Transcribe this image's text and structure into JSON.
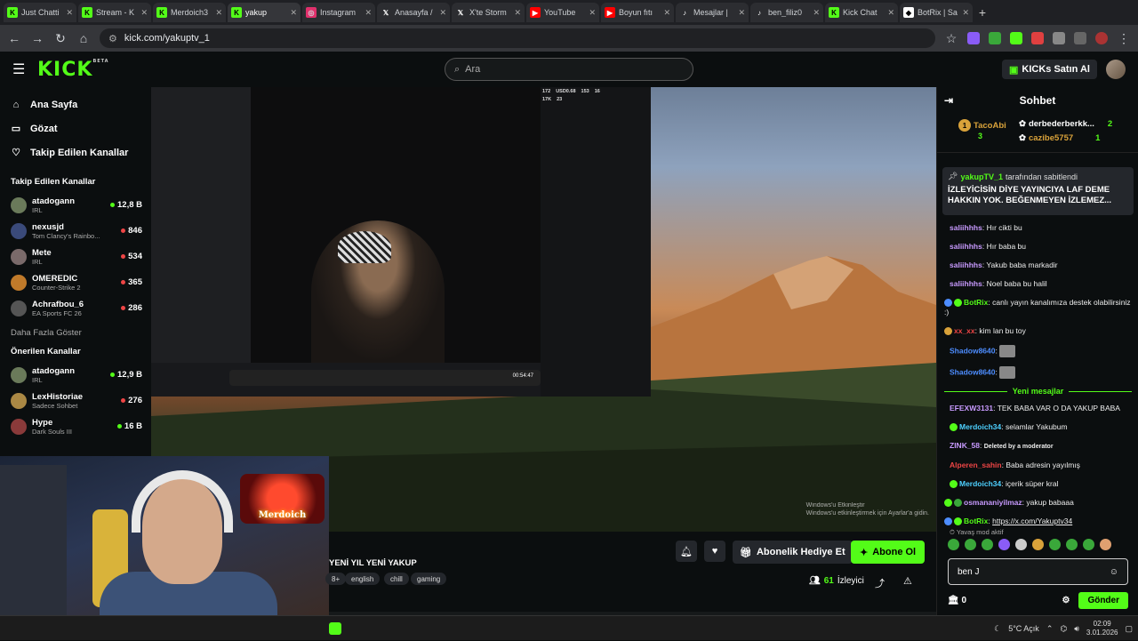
{
  "browser": {
    "tabs": [
      {
        "label": "Just Chatti",
        "color": "#53fc18",
        "icon": "kick-icon"
      },
      {
        "label": "Stream - K",
        "color": "#53fc18",
        "icon": "kick-icon"
      },
      {
        "label": "Merdoich3",
        "color": "#53fc18",
        "icon": "kick-icon"
      },
      {
        "label": "yakup",
        "color": "#53fc18",
        "icon": "kick-icon",
        "active": true
      },
      {
        "label": "Instagram",
        "color": "#e1306c",
        "icon": "instagram-icon"
      },
      {
        "label": "Anasayfa /",
        "color": "#ffffff",
        "icon": "x-icon"
      },
      {
        "label": "X'te Storm",
        "color": "#ffffff",
        "icon": "x-icon"
      },
      {
        "label": "YouTube",
        "color": "#ff0000",
        "icon": "youtube-icon"
      },
      {
        "label": "Boyun fıtı",
        "color": "#ff0000",
        "icon": "youtube-icon"
      },
      {
        "label": "Mesajlar |",
        "color": "#ffffff",
        "icon": "tiktok-icon"
      },
      {
        "label": "ben_filiz0",
        "color": "#ffffff",
        "icon": "tiktok-icon"
      },
      {
        "label": "Kick Chat",
        "color": "#53fc18",
        "icon": "kick-icon"
      },
      {
        "label": "BotRix | Sa",
        "color": "#ffffff",
        "icon": "botrix-icon"
      }
    ],
    "url": "kick.com/yakuptv_1"
  },
  "header": {
    "logo": "KICK",
    "logo_sup": "BETA",
    "search_placeholder": "Ara",
    "buy_kicks": "KICKs Satın Al"
  },
  "sidebar": {
    "nav": [
      {
        "label": "Ana Sayfa",
        "icon": "home-icon",
        "glyph": "⌂"
      },
      {
        "label": "Gözat",
        "icon": "browse-icon",
        "glyph": "▭"
      },
      {
        "label": "Takip Edilen Kanallar",
        "icon": "heart-icon",
        "glyph": "♡"
      }
    ],
    "followed_title": "Takip Edilen Kanallar",
    "followed": [
      {
        "name": "atadogann",
        "category": "IRL",
        "viewers": "12,8 B",
        "live": "green",
        "avatar": "#6a7a5a"
      },
      {
        "name": "nexusjd",
        "category": "Tom Clancy's Rainbo...",
        "viewers": "846",
        "live": "red",
        "avatar": "#3a4a7a"
      },
      {
        "name": "Mete",
        "category": "IRL",
        "viewers": "534",
        "live": "red",
        "avatar": "#7a6a6a"
      },
      {
        "name": "OMEREDIC",
        "category": "Counter-Strike 2",
        "viewers": "365",
        "live": "red",
        "avatar": "#c07a2a"
      },
      {
        "name": "Achrafbou_6",
        "category": "EA Sports FC 26",
        "viewers": "286",
        "live": "red",
        "avatar": "#555"
      }
    ],
    "show_more": "Daha Fazla Göster",
    "recommended_title": "Önerilen Kanallar",
    "recommended": [
      {
        "name": "atadogann",
        "category": "IRL",
        "viewers": "12,9 B",
        "live": "green",
        "avatar": "#6a7a5a"
      },
      {
        "name": "LexHistoriae",
        "category": "Sadece Sohbet",
        "viewers": "276",
        "live": "red",
        "avatar": "#aa8844"
      },
      {
        "name": "Hype",
        "category": "Dark Souls III",
        "viewers": "16 B",
        "live": "green",
        "avatar": "#8a3a3a"
      }
    ]
  },
  "video": {
    "watermark_line1": "Windows'u Etkinleştir",
    "watermark_line2": "Windows'u etkinleştirmek için Ayarlar'a gidin.",
    "stream_clock": "00:54:47",
    "stats": [
      "172",
      "USD0.68",
      "153",
      "16",
      "17K",
      "23"
    ],
    "webcam_sign": "Merdoich"
  },
  "stream_info": {
    "title": "YENİ YIL YENİ YAKUP",
    "tags": [
      "8+",
      "english",
      "chill",
      "gaming"
    ],
    "gift_label": "Abonelik Hediye Et",
    "subscribe_label": "Abone Ol",
    "viewer_count": "61",
    "viewer_label": "İzleyici"
  },
  "chat": {
    "title": "Sohbet",
    "top_gifters": [
      {
        "name": "TacoAbi",
        "rank": "1",
        "count": "3"
      },
      {
        "name": "derbederberkk...",
        "count": "2"
      },
      {
        "name": "cazibe5757",
        "count": "1"
      }
    ],
    "pinned_by": "yakupTV_1",
    "pinned_suffix": "tarafından sabitlendi",
    "pinned_message": "İZLEYİCİSİN DİYE YAYINCIYA LAF DEME HAKKIN YOK. BEĞENMEYEN İZLEMEZ...",
    "messages": [
      {
        "user": "saliihhhs",
        "text": "Hır cikti bu",
        "color": "#c89aff"
      },
      {
        "user": "saliihhhs",
        "text": "Hır baba bu",
        "color": "#c89aff"
      },
      {
        "user": "saliihhhs",
        "text": "Yakub baba markadir",
        "color": "#c89aff"
      },
      {
        "user": "saliihhhs",
        "text": "Noel baba bu halil",
        "color": "#c89aff"
      },
      {
        "user": "BotRix",
        "text": "canlı yayın kanalımıza destek olabilirsiniz :)",
        "color": "#53fc18"
      },
      {
        "user": "xx_xx",
        "text": "kim lan bu toy",
        "color": "#ee4545"
      },
      {
        "user": "Shadow8640",
        "text": "",
        "color": "#4d8dff"
      },
      {
        "user": "Shadow8640",
        "text": "",
        "color": "#4d8dff"
      }
    ],
    "new_messages_label": "Yeni mesajlar",
    "new_messages": [
      {
        "user": "EFEXW3131",
        "text": "TEK BABA VAR O DA YAKUP BABA",
        "color": "#c89aff"
      },
      {
        "user": "Merdoich34",
        "text": "selamlar Yakubum",
        "color": "#4dd0ff"
      },
      {
        "user": "ZINK_58",
        "text": "Deleted by a moderator",
        "color": "#c89aff"
      },
      {
        "user": "Alperen_sahin",
        "text": "Baba adresin yayılmış",
        "color": "#ee4545"
      },
      {
        "user": "Merdoich34",
        "text": "içerik süper kral",
        "color": "#4dd0ff"
      },
      {
        "user": "osmananiyilmaz",
        "text": "yakup babaaa",
        "color": "#c89aff"
      },
      {
        "user": "BotRix",
        "text": "https://x.com/Yakuptv34",
        "color": "#53fc18"
      }
    ],
    "slow_mode": "Yavaş mod aktif",
    "input_value": "ben J",
    "points": "0",
    "send_label": "Gönder"
  },
  "taskbar": {
    "weather": "5°C  Açık",
    "time": "02:09",
    "date": "3.01.2026"
  }
}
